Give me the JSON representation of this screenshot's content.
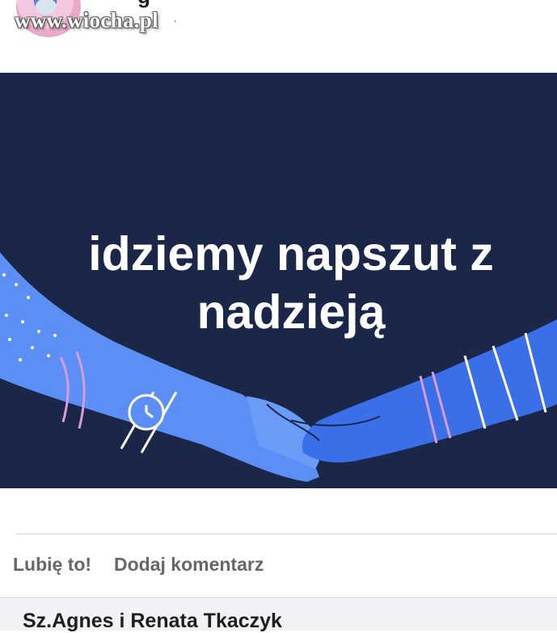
{
  "header": {
    "watermark": "www.wiocha.pl",
    "name_fragment": "g",
    "dots": ". ."
  },
  "post": {
    "text_line1": "idziemy napszut z",
    "text_line2": "nadzieją",
    "background_color": "#1b2748"
  },
  "actions": {
    "like_label": "Lubię to!",
    "comment_label": "Dodaj komentarz"
  },
  "comments": {
    "first_author": "Sz.Agnes i Renata Tkaczyk"
  }
}
